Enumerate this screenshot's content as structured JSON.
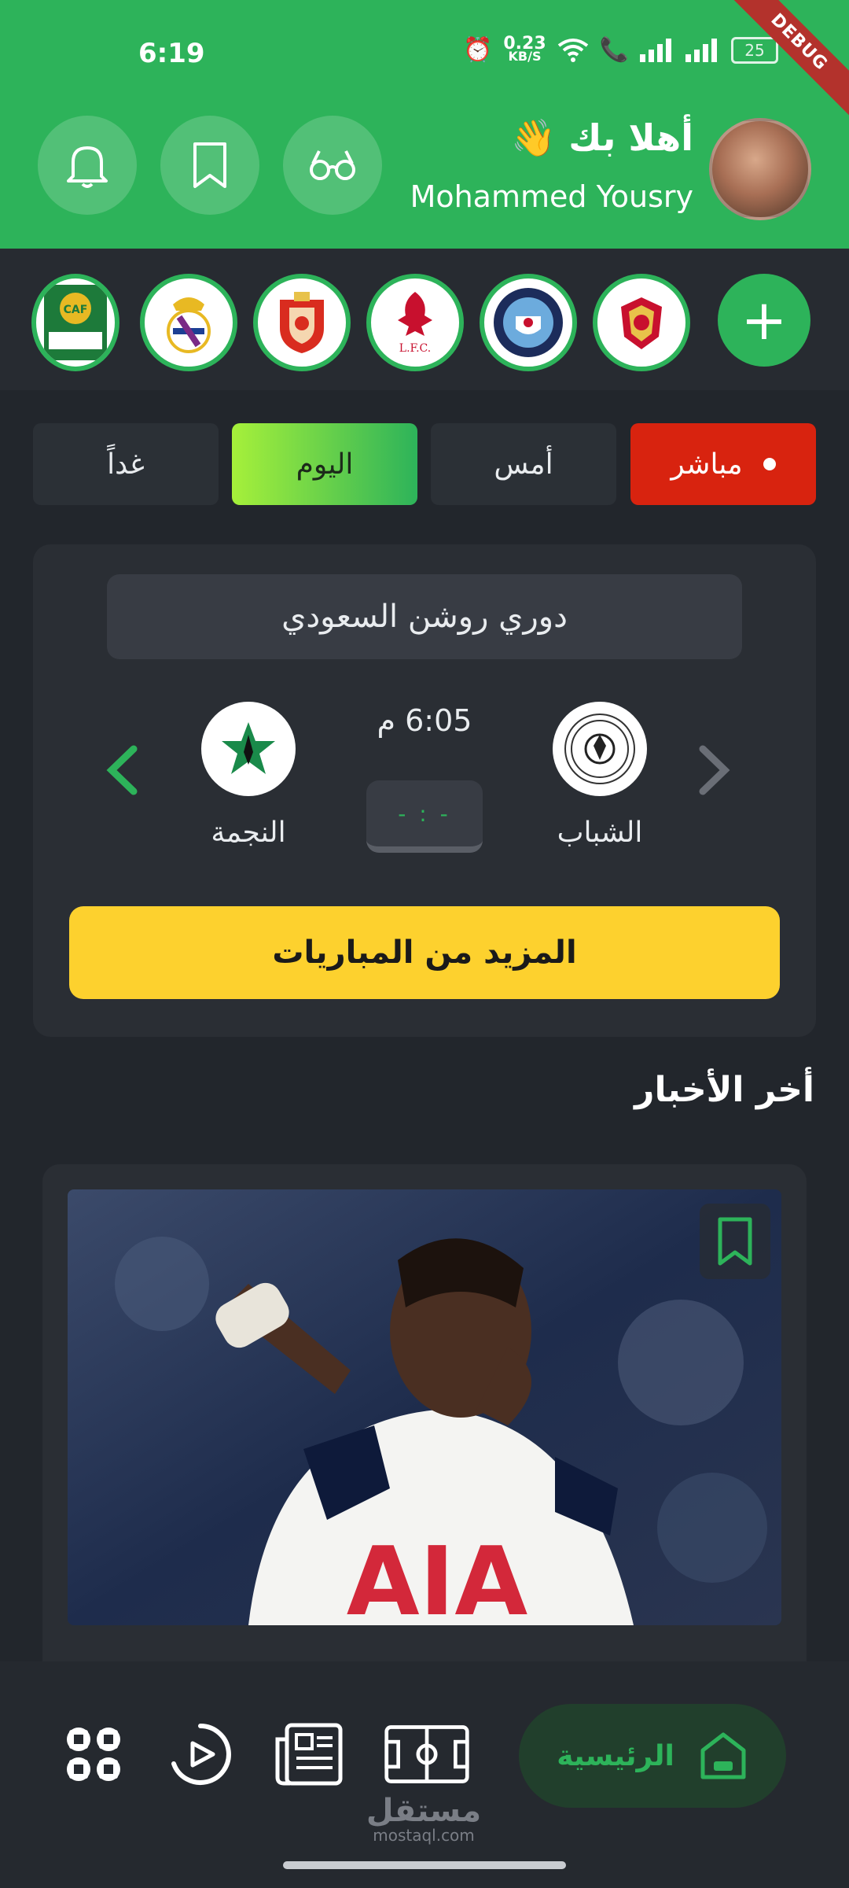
{
  "status_bar": {
    "time": "6:19",
    "speed_value": "0.23",
    "speed_unit": "KB/S",
    "battery": "25",
    "debug_label": "DEBUG"
  },
  "header": {
    "greeting": "أهلا بك 👋",
    "username": "Mohammed Yousry",
    "accent_color": "#2db35a"
  },
  "teams": {
    "add_label": "+",
    "logos": [
      "al-ahly-logo",
      "manchester-city-logo",
      "liverpool-logo",
      "club-crest-logo",
      "real-madrid-logo",
      "caf-champions-league-logo"
    ],
    "liverpool_text": "L.F.C."
  },
  "date_tabs": [
    {
      "label": "مباشر",
      "state": "live"
    },
    {
      "label": "أمس",
      "state": "normal"
    },
    {
      "label": "اليوم",
      "state": "selected"
    },
    {
      "label": "غداً",
      "state": "normal"
    }
  ],
  "match": {
    "league": "دوري روشن السعودي",
    "home_team": "الشباب",
    "away_team": "النجمة",
    "time": "6:05 م",
    "score": "- : -",
    "more_button": "المزيد من المباريات"
  },
  "news": {
    "section_title": "أخر الأخبار",
    "shirt_sponsor": "AIA"
  },
  "bottom_nav": {
    "home_label": "الرئيسية",
    "items": [
      "grid-icon",
      "video-play-icon",
      "newspaper-icon",
      "football-pitch-icon"
    ]
  },
  "watermark": {
    "title": "مستقل",
    "url": "mostaql.com"
  }
}
